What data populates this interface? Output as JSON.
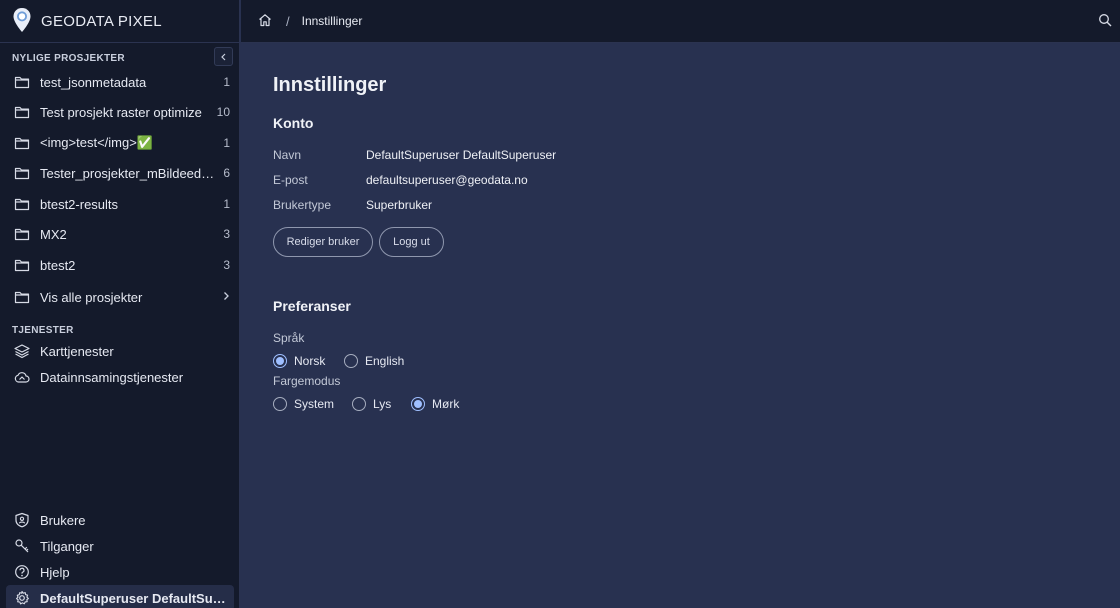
{
  "app": {
    "name": "GEODATA PIXEL"
  },
  "sidebar": {
    "recent_heading": "NYLIGE PROSJEKTER",
    "projects": [
      {
        "label": "test_jsonmetadata",
        "count": "1"
      },
      {
        "label": "Test prosjekt raster optimize",
        "count": "10"
      },
      {
        "label": "<img>test</img>✅",
        "count": "1"
      },
      {
        "label": "Tester_prosjekter_mBildeed_n...",
        "count": "6"
      },
      {
        "label": "btest2-results",
        "count": "1"
      },
      {
        "label": "MX2",
        "count": "3"
      },
      {
        "label": "btest2",
        "count": "3"
      }
    ],
    "show_all": "Vis alle prosjekter",
    "services_heading": "TJENESTER",
    "services": [
      {
        "label": "Karttjenester",
        "icon": "layers-icon"
      },
      {
        "label": "Datainnsamingstjenester",
        "icon": "cloud-icon"
      }
    ],
    "bottom": [
      {
        "label": "Brukere",
        "icon": "shield-user-icon"
      },
      {
        "label": "Tilganger",
        "icon": "key-icon"
      },
      {
        "label": "Hjelp",
        "icon": "help-icon"
      }
    ],
    "user": "DefaultSuperuser DefaultSuper..."
  },
  "breadcrumb": {
    "current": "Innstillinger",
    "separator": "/"
  },
  "page": {
    "title": "Innstillinger",
    "account": {
      "heading": "Konto",
      "fields": [
        {
          "label": "Navn",
          "value": "DefaultSuperuser DefaultSuperuser"
        },
        {
          "label": "E-post",
          "value": "defaultsuperuser@geodata.no"
        },
        {
          "label": "Brukertype",
          "value": "Superbruker"
        }
      ],
      "edit_button": "Rediger bruker",
      "logout_button": "Logg ut"
    },
    "preferences": {
      "heading": "Preferanser",
      "language_label": "Språk",
      "language_options": [
        "Norsk",
        "English"
      ],
      "language_selected": "Norsk",
      "color_label": "Fargemodus",
      "color_options": [
        "System",
        "Lys",
        "Mørk"
      ],
      "color_selected": "Mørk"
    }
  },
  "colors": {
    "sidebar_bg": "#141a2b",
    "main_bg": "#283150",
    "accent": "#9fbfff"
  }
}
